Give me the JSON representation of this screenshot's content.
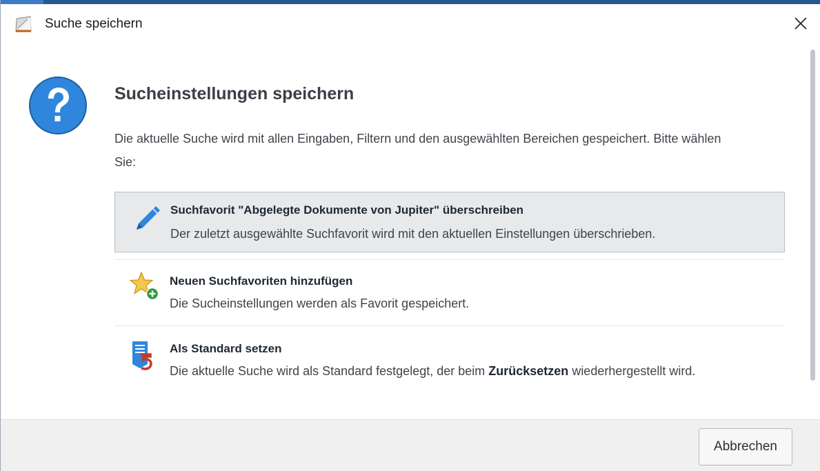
{
  "window": {
    "title": "Suche speichern",
    "icon": "app-icon",
    "close_icon": "close-icon"
  },
  "colors": {
    "accent_bar": "#27578f",
    "question_icon": "#2f86dc",
    "selected_option_bg": "#e8e9eb",
    "footer_bg": "#f0f0f1"
  },
  "main": {
    "icon": "question-icon",
    "heading": "Sucheinstellungen speichern",
    "description": "Die aktuelle Suche wird mit allen Eingaben, Filtern und den ausgewählten Bereichen gespeichert. Bitte wählen Sie:"
  },
  "options": [
    {
      "icon": "pencil-icon",
      "title": "Suchfavorit \"Abgelegte Dokumente von Jupiter\" überschreiben",
      "description": "Der zuletzt ausgewählte Suchfavorit wird mit den aktuellen Einstellungen überschrieben.",
      "selected": true
    },
    {
      "icon": "star-add-icon",
      "title": "Neuen Suchfavoriten hinzufügen",
      "description": "Die Sucheinstellungen werden als Favorit gespeichert.",
      "selected": false
    },
    {
      "icon": "default-setting-icon",
      "title": "Als Standard setzen",
      "description_before": "Die aktuelle Suche wird als Standard festgelegt, der beim ",
      "description_bold": "Zurücksetzen",
      "description_after": " wiederhergestellt wird.",
      "selected": false
    }
  ],
  "footer": {
    "cancel_label": "Abbrechen"
  }
}
